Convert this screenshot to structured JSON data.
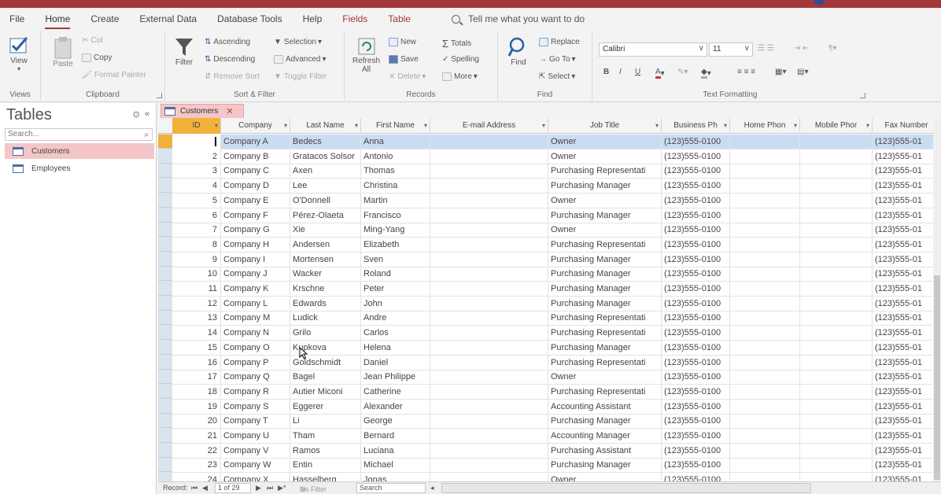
{
  "ribbon_tabs": [
    "File",
    "Home",
    "Create",
    "External Data",
    "Database Tools",
    "Help",
    "Fields",
    "Table"
  ],
  "tell_me": "Tell me what you want to do",
  "views": {
    "view": "View",
    "group": "Views"
  },
  "clipboard": {
    "paste": "Paste",
    "cut": "Cut",
    "copy": "Copy",
    "format_painter": "Format Painter",
    "group": "Clipboard"
  },
  "sort_filter": {
    "filter": "Filter",
    "ascending": "Ascending",
    "descending": "Descending",
    "remove_sort": "Remove Sort",
    "selection": "Selection",
    "advanced": "Advanced",
    "toggle_filter": "Toggle Filter",
    "group": "Sort & Filter"
  },
  "records": {
    "refresh": "Refresh",
    "refresh_sub": "All",
    "new": "New",
    "save": "Save",
    "delete": "Delete",
    "totals": "Totals",
    "spelling": "Spelling",
    "more": "More",
    "group": "Records"
  },
  "find": {
    "find": "Find",
    "replace": "Replace",
    "goto": "Go To",
    "select": "Select",
    "group": "Find"
  },
  "text_formatting": {
    "font": "Calibri",
    "size": "11",
    "group": "Text Formatting"
  },
  "nav": {
    "title": "Tables",
    "search_placeholder": "Search...",
    "items": [
      {
        "label": "Customers"
      },
      {
        "label": "Employees"
      }
    ]
  },
  "doc_tab": "Customers",
  "columns": [
    "ID",
    "Company",
    "Last Name",
    "First Name",
    "E-mail Address",
    "Job Title",
    "Business Ph",
    "Home Phon",
    "Mobile Phor",
    "Fax Number"
  ],
  "rows": [
    [
      "1",
      "Company A",
      "Bedecs",
      "Anna",
      "",
      "Owner",
      "(123)555-0100",
      "",
      "",
      "(123)555-01"
    ],
    [
      "2",
      "Company B",
      "Gratacos Solsor",
      "Antonio",
      "",
      "Owner",
      "(123)555-0100",
      "",
      "",
      "(123)555-01"
    ],
    [
      "3",
      "Company C",
      "Axen",
      "Thomas",
      "",
      "Purchasing Representati",
      "(123)555-0100",
      "",
      "",
      "(123)555-01"
    ],
    [
      "4",
      "Company D",
      "Lee",
      "Christina",
      "",
      "Purchasing Manager",
      "(123)555-0100",
      "",
      "",
      "(123)555-01"
    ],
    [
      "5",
      "Company E",
      "O'Donnell",
      "Martin",
      "",
      "Owner",
      "(123)555-0100",
      "",
      "",
      "(123)555-01"
    ],
    [
      "6",
      "Company F",
      "Pérez-Olaeta",
      "Francisco",
      "",
      "Purchasing Manager",
      "(123)555-0100",
      "",
      "",
      "(123)555-01"
    ],
    [
      "7",
      "Company G",
      "Xie",
      "Ming-Yang",
      "",
      "Owner",
      "(123)555-0100",
      "",
      "",
      "(123)555-01"
    ],
    [
      "8",
      "Company H",
      "Andersen",
      "Elizabeth",
      "",
      "Purchasing Representati",
      "(123)555-0100",
      "",
      "",
      "(123)555-01"
    ],
    [
      "9",
      "Company I",
      "Mortensen",
      "Sven",
      "",
      "Purchasing Manager",
      "(123)555-0100",
      "",
      "",
      "(123)555-01"
    ],
    [
      "10",
      "Company J",
      "Wacker",
      "Roland",
      "",
      "Purchasing Manager",
      "(123)555-0100",
      "",
      "",
      "(123)555-01"
    ],
    [
      "11",
      "Company K",
      "Krschne",
      "Peter",
      "",
      "Purchasing Manager",
      "(123)555-0100",
      "",
      "",
      "(123)555-01"
    ],
    [
      "12",
      "Company L",
      "Edwards",
      "John",
      "",
      "Purchasing Manager",
      "(123)555-0100",
      "",
      "",
      "(123)555-01"
    ],
    [
      "13",
      "Company M",
      "Ludick",
      "Andre",
      "",
      "Purchasing Representati",
      "(123)555-0100",
      "",
      "",
      "(123)555-01"
    ],
    [
      "14",
      "Company N",
      "Grilo",
      "Carlos",
      "",
      "Purchasing Representati",
      "(123)555-0100",
      "",
      "",
      "(123)555-01"
    ],
    [
      "15",
      "Company O",
      "Kupkova",
      "Helena",
      "",
      "Purchasing Manager",
      "(123)555-0100",
      "",
      "",
      "(123)555-01"
    ],
    [
      "16",
      "Company P",
      "Goldschmidt",
      "Daniel",
      "",
      "Purchasing Representati",
      "(123)555-0100",
      "",
      "",
      "(123)555-01"
    ],
    [
      "17",
      "Company Q",
      "Bagel",
      "Jean Philippe",
      "",
      "Owner",
      "(123)555-0100",
      "",
      "",
      "(123)555-01"
    ],
    [
      "18",
      "Company R",
      "Autier Miconi",
      "Catherine",
      "",
      "Purchasing Representati",
      "(123)555-0100",
      "",
      "",
      "(123)555-01"
    ],
    [
      "19",
      "Company S",
      "Eggerer",
      "Alexander",
      "",
      "Accounting Assistant",
      "(123)555-0100",
      "",
      "",
      "(123)555-01"
    ],
    [
      "20",
      "Company T",
      "Li",
      "George",
      "",
      "Purchasing Manager",
      "(123)555-0100",
      "",
      "",
      "(123)555-01"
    ],
    [
      "21",
      "Company U",
      "Tham",
      "Bernard",
      "",
      "Accounting Manager",
      "(123)555-0100",
      "",
      "",
      "(123)555-01"
    ],
    [
      "22",
      "Company V",
      "Ramos",
      "Luciana",
      "",
      "Purchasing Assistant",
      "(123)555-0100",
      "",
      "",
      "(123)555-01"
    ],
    [
      "23",
      "Company W",
      "Entin",
      "Michael",
      "",
      "Purchasing Manager",
      "(123)555-0100",
      "",
      "",
      "(123)555-01"
    ],
    [
      "24",
      "Company X",
      "Hasselberg",
      "Jonas",
      "",
      "Owner",
      "(123)555-0100",
      "",
      "",
      "(123)555-01"
    ]
  ],
  "record_nav": {
    "label": "Record:",
    "position": "1 of 29",
    "no_filter": "No Filter",
    "search": "Search"
  }
}
